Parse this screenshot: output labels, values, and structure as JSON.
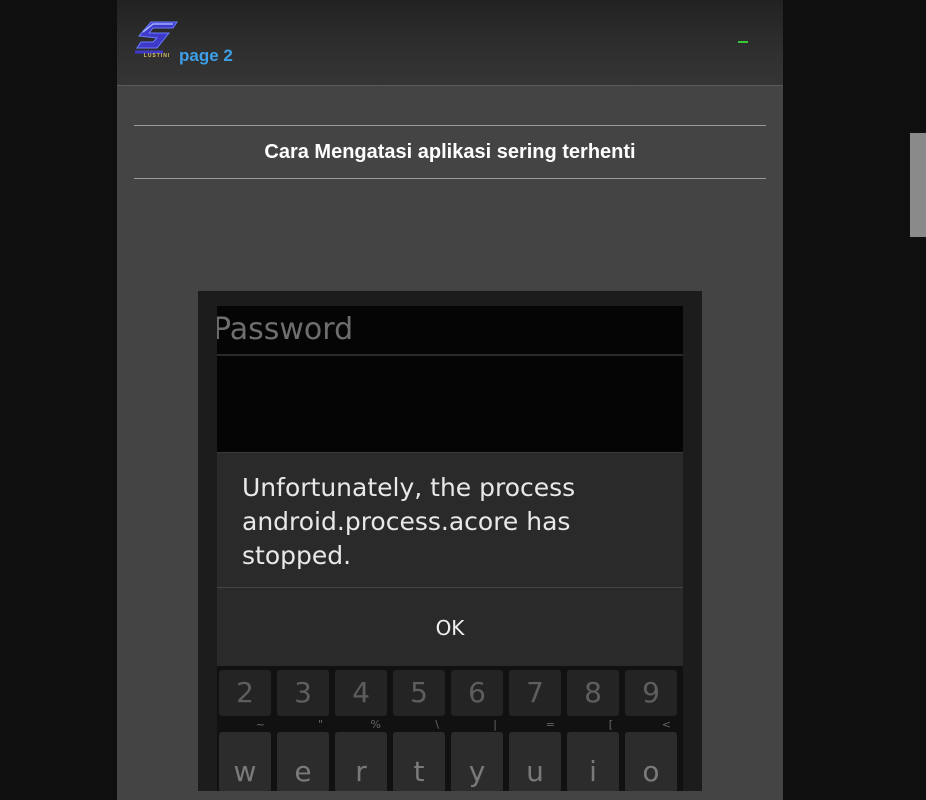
{
  "header": {
    "logo_caption": "LUSTINI",
    "page_link": "page 2",
    "menu_icon": "minus-icon"
  },
  "post": {
    "title": "Cara Mengatasi aplikasi sering terhenti"
  },
  "screenshot": {
    "password_placeholder": "Password",
    "error_message": "Unfortunately, the process android.process.acore has stopped.",
    "ok_label": "OK",
    "number_keys": [
      "2",
      "3",
      "4",
      "5",
      "6",
      "7",
      "8",
      "9"
    ],
    "letter_keys": [
      "w",
      "e",
      "r",
      "t",
      "y",
      "u",
      "i",
      "o"
    ],
    "letter_symbols": [
      "~",
      "\"",
      "%",
      "\\",
      "|",
      "=",
      "[",
      "<"
    ]
  },
  "colors": {
    "link": "#3d9fe8",
    "menu_dash": "#38c838",
    "page_bg": "#444444"
  }
}
